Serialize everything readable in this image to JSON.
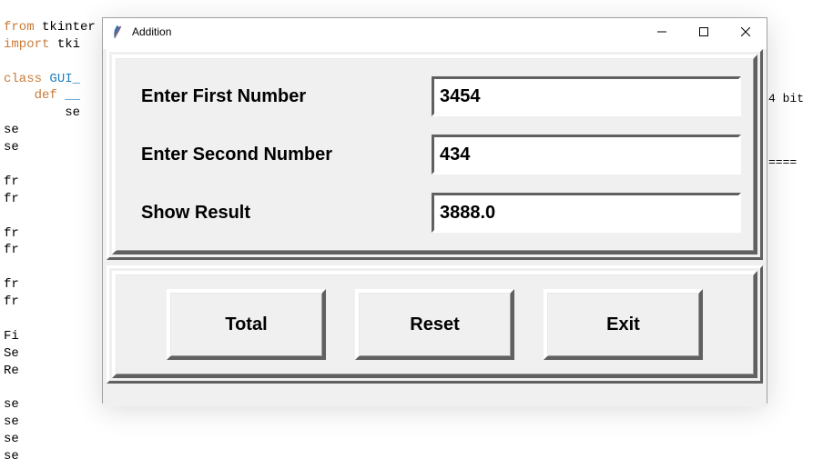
{
  "code": {
    "l1a": "from",
    "l1b": "tkinter",
    "l1c": "import",
    "l1d": "*",
    "l2a": "import",
    "l2b": "tki",
    "l4a": "class",
    "l4b": "GUI_",
    "l5a": "def",
    "col2": "se\nse\nse\n\nfr\nfr\n\nfr\nfr\n\nfr\nfr\n\nFi\nSe\nRe\n\nse\nse\nse\nse"
  },
  "tk": {
    "title": "Addition",
    "labels": {
      "first": "Enter First Number",
      "second": "Enter Second Number",
      "result": "Show Result"
    },
    "values": {
      "first": "3454",
      "second": "434",
      "result": "3888.0"
    },
    "buttons": {
      "total": "Total",
      "reset": "Reset",
      "exit": "Exit"
    }
  },
  "right": {
    "bits": "4 bit",
    "sep": "===="
  }
}
